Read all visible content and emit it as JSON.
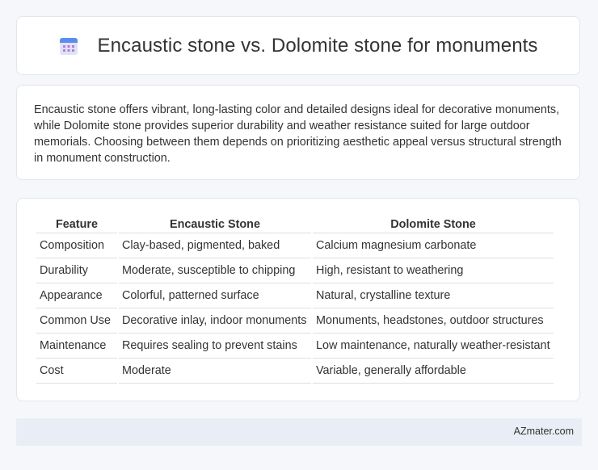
{
  "header": {
    "title": "Encaustic stone vs. Dolomite stone for monuments",
    "icon": "calendar-icon"
  },
  "summary": {
    "text": "Encaustic stone offers vibrant, long-lasting color and detailed designs ideal for decorative monuments, while Dolomite stone provides superior durability and weather resistance suited for large outdoor memorials. Choosing between them depends on prioritizing aesthetic appeal versus structural strength in monument construction."
  },
  "table": {
    "headers": [
      "Feature",
      "Encaustic Stone",
      "Dolomite Stone"
    ],
    "rows": [
      [
        "Composition",
        "Clay-based, pigmented, baked",
        "Calcium magnesium carbonate"
      ],
      [
        "Durability",
        "Moderate, susceptible to chipping",
        "High, resistant to weathering"
      ],
      [
        "Appearance",
        "Colorful, patterned surface",
        "Natural, crystalline texture"
      ],
      [
        "Common Use",
        "Decorative inlay, indoor monuments",
        "Monuments, headstones, outdoor structures"
      ],
      [
        "Maintenance",
        "Requires sealing to prevent stains",
        "Low maintenance, naturally weather-resistant"
      ],
      [
        "Cost",
        "Moderate",
        "Variable, generally affordable"
      ]
    ]
  },
  "footer": {
    "brand": "AZmater.com"
  }
}
